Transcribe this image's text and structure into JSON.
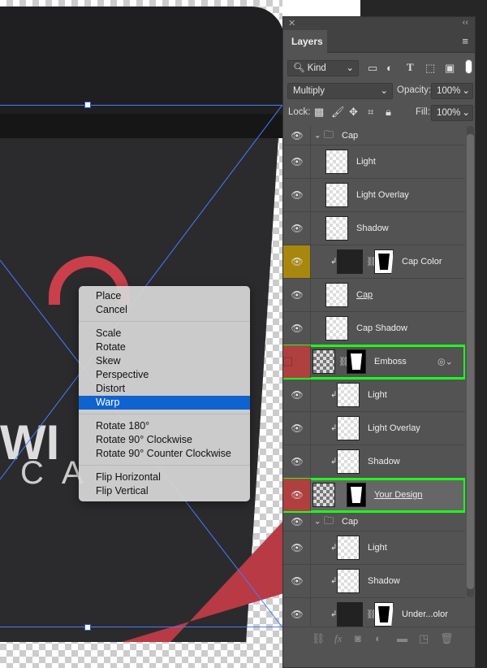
{
  "context_menu": {
    "groups": [
      [
        "Place",
        "Cancel"
      ],
      [
        "Scale",
        "Rotate",
        "Skew",
        "Perspective",
        "Distort",
        "Warp"
      ],
      [
        "Rotate 180°",
        "Rotate 90° Clockwise",
        "Rotate 90° Counter Clockwise"
      ],
      [
        "Flip Horizontal",
        "Flip Vertical"
      ]
    ],
    "selected": "Warp"
  },
  "canvas": {
    "brand_text": "WI",
    "brand_sub": "CA"
  },
  "panel": {
    "title": "Layers",
    "filter": "Kind",
    "blend_mode": "Multiply",
    "opacity_label": "Opacity:",
    "opacity": "100%",
    "lock_label": "Lock:",
    "fill_label": "Fill:",
    "fill": "100%",
    "filter_icons": [
      "image-filter-icon",
      "adjustment-filter-icon",
      "type-filter-icon",
      "shape-filter-icon",
      "smart-object-filter-icon"
    ],
    "lock_icons": [
      "lock-transparent-icon",
      "lock-paint-icon",
      "lock-position-icon",
      "lock-artboard-icon",
      "lock-all-icon"
    ],
    "footer_icons": [
      "link-icon",
      "fx-icon",
      "mask-icon",
      "adjustment-icon",
      "group-icon",
      "new-layer-icon",
      "trash-icon"
    ]
  },
  "layers": [
    {
      "name": "Cap",
      "type": "group",
      "visible": true
    },
    {
      "name": "Light",
      "visible": true,
      "indent": true
    },
    {
      "name": "Light Overlay",
      "visible": true,
      "indent": true
    },
    {
      "name": "Shadow",
      "visible": true,
      "indent": true
    },
    {
      "name": "Cap Color",
      "visible": true,
      "clipped": true,
      "fill": true,
      "eye_color": "#a8870f"
    },
    {
      "name": "Cap",
      "visible": true,
      "underline": true
    },
    {
      "name": "Cap Shadow",
      "visible": true
    },
    {
      "name": "Emboss",
      "visible": false,
      "smart": true,
      "highlight": true,
      "eye_color": "#b04040"
    },
    {
      "name": "Light",
      "visible": true,
      "clipped": true
    },
    {
      "name": "Light Overlay",
      "visible": true,
      "clipped": true
    },
    {
      "name": "Shadow",
      "visible": true,
      "clipped": true
    },
    {
      "name": "Your Design",
      "visible": true,
      "smart": true,
      "highlight": true,
      "selected": true,
      "underline": true,
      "eye_color": "#b04040"
    },
    {
      "name": "Cap",
      "type": "group",
      "visible": true
    },
    {
      "name": "Light",
      "visible": true,
      "clipped": true
    },
    {
      "name": "Shadow",
      "visible": true,
      "clipped": true
    },
    {
      "name": "Under...olor",
      "visible": true,
      "clipped": true,
      "fill": true
    }
  ],
  "colors": {
    "highlight_outline": "#1aff1a",
    "menu_selection": "#0f63d0",
    "panel_bg": "#535353"
  }
}
